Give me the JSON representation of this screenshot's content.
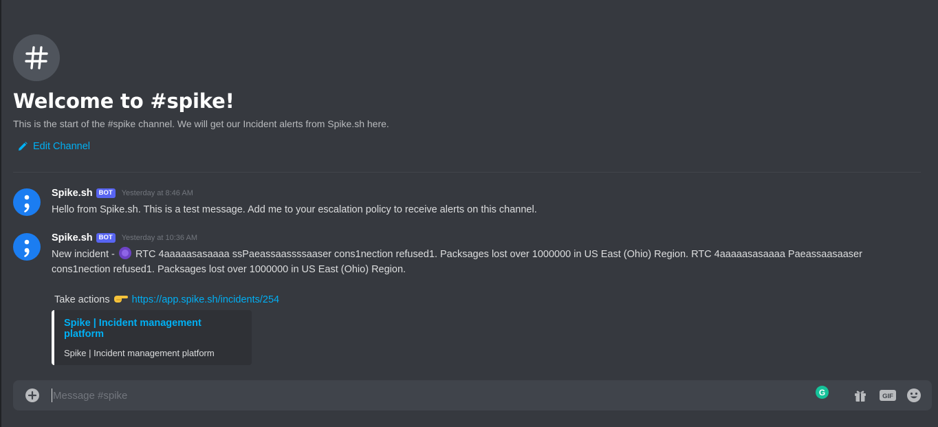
{
  "welcome": {
    "title": "Welcome to #spike!",
    "subtitle": "This is the start of the #spike channel. We will get our Incident alerts from Spike.sh here.",
    "edit_label": "Edit Channel"
  },
  "messages": [
    {
      "author": "Spike.sh",
      "badge": "BOT",
      "timestamp": "Yesterday at 8:46 AM",
      "text": "Hello from Spike.sh. This is a test message. Add me to your escalation policy to receive alerts on this channel."
    },
    {
      "author": "Spike.sh",
      "badge": "BOT",
      "timestamp": "Yesterday at 10:36 AM",
      "text_prefix": "New incident - ",
      "text_main": "RTC 4aaaaasasaaaa ssPaeassaassssaaser cons1nection refused1. Packsages lost over 1000000 in US East (Ohio) Region. RTC 4aaaaasasaaaa Paeassaasaaser cons1nection refused1. Packsages lost over 1000000 in US East (Ohio) Region.",
      "actions_label": "Take actions",
      "link": "https://app.spike.sh/incidents/254",
      "embed": {
        "title": "Spike | Incident management platform",
        "description": "Spike | Incident management platform"
      }
    }
  ],
  "composer": {
    "placeholder": "Message #spike",
    "grammarly_letter": "G",
    "gif_label": "GIF"
  },
  "colors": {
    "background": "#36393f",
    "accent_link": "#00b0f4",
    "bot_badge": "#5865f2",
    "avatar": "#1b7df1",
    "composer": "#40444b"
  },
  "icons": [
    "hash-icon",
    "pencil-icon",
    "semicolon-logo-icon",
    "alien-monster-emoji-icon",
    "pointing-hand-emoji-icon",
    "plus-circle-icon",
    "grammarly-icon",
    "gift-icon",
    "gif-icon",
    "smiley-icon"
  ]
}
